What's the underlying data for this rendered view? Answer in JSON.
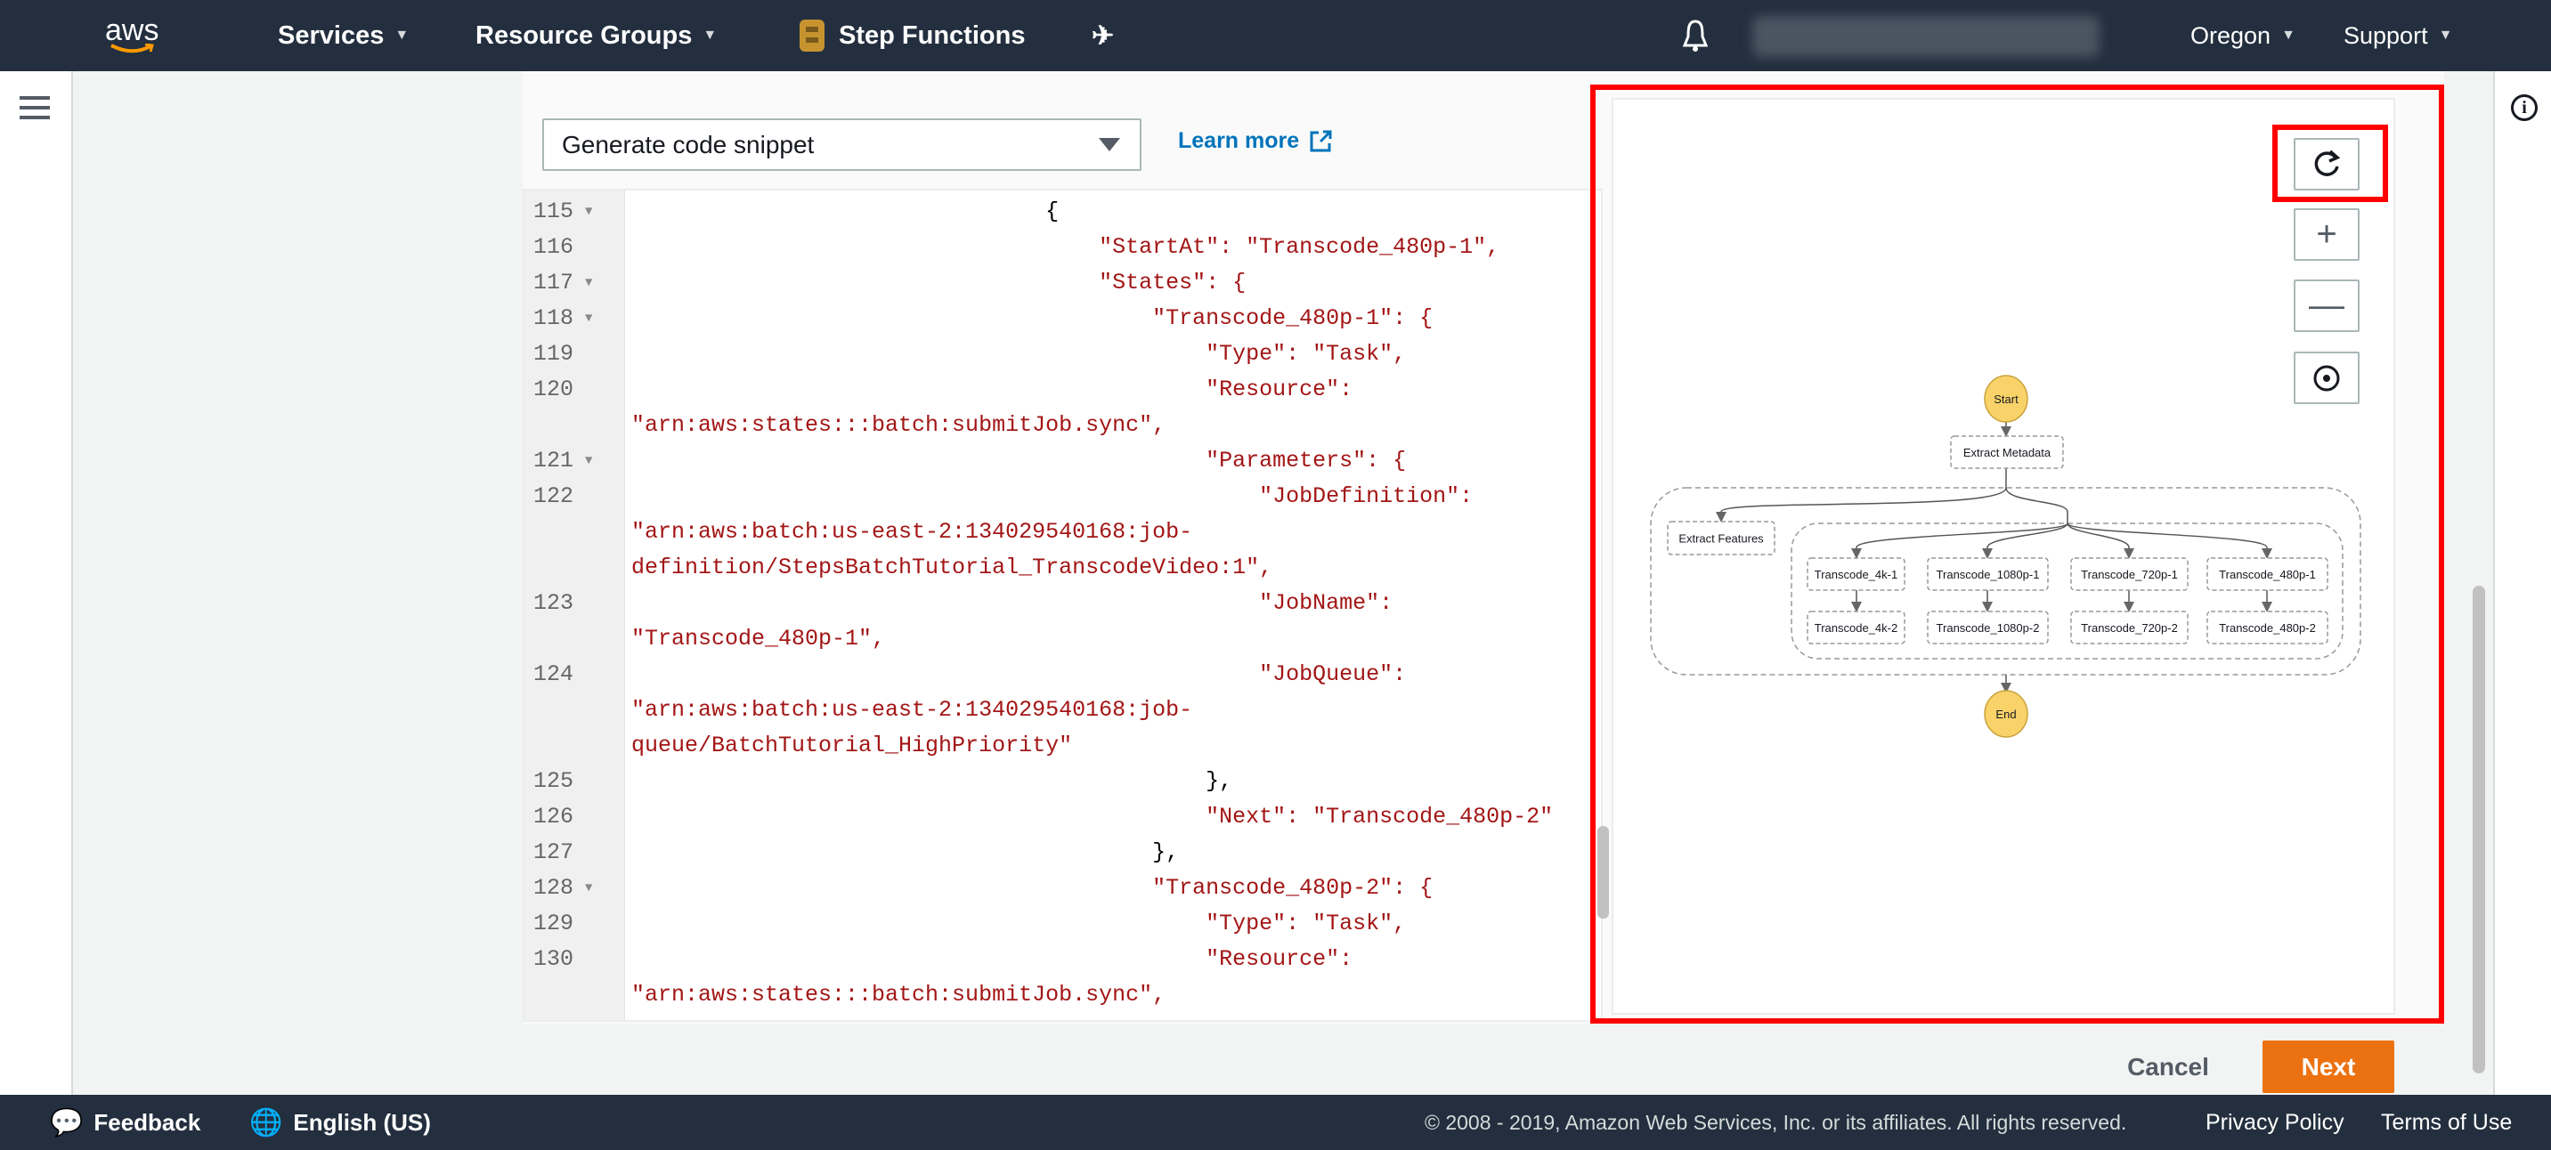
{
  "topnav": {
    "logo": "aws",
    "services": "Services",
    "resource_groups": "Resource Groups",
    "step_functions": "Step Functions",
    "account": "",
    "region": "Oregon",
    "support": "Support",
    "icons": [
      "pin-icon",
      "bell-icon"
    ]
  },
  "toolbar": {
    "snippet_select": "Generate code snippet",
    "learn_more": "Learn more"
  },
  "editor": {
    "rows": [
      {
        "ln": "115",
        "fold": true,
        "text": "                               {"
      },
      {
        "ln": "116",
        "fold": false,
        "text": "                                   \"StartAt\": \"Transcode_480p-1\","
      },
      {
        "ln": "117",
        "fold": true,
        "text": "                                   \"States\": {"
      },
      {
        "ln": "118",
        "fold": true,
        "text": "                                       \"Transcode_480p-1\": {"
      },
      {
        "ln": "119",
        "fold": false,
        "text": "                                           \"Type\": \"Task\","
      },
      {
        "ln": "120",
        "fold": false,
        "text": "                                           \"Resource\":"
      },
      {
        "ln": "",
        "fold": false,
        "text": "\"arn:aws:states:::batch:submitJob.sync\","
      },
      {
        "ln": "121",
        "fold": true,
        "text": "                                           \"Parameters\": {"
      },
      {
        "ln": "122",
        "fold": false,
        "text": "                                               \"JobDefinition\":"
      },
      {
        "ln": "",
        "fold": false,
        "text": "\"arn:aws:batch:us-east-2:134029540168:job-"
      },
      {
        "ln": "",
        "fold": false,
        "text": "definition/StepsBatchTutorial_TranscodeVideo:1\","
      },
      {
        "ln": "123",
        "fold": false,
        "text": "                                               \"JobName\":"
      },
      {
        "ln": "",
        "fold": false,
        "text": "\"Transcode_480p-1\","
      },
      {
        "ln": "124",
        "fold": false,
        "text": "                                               \"JobQueue\":"
      },
      {
        "ln": "",
        "fold": false,
        "text": "\"arn:aws:batch:us-east-2:134029540168:job-"
      },
      {
        "ln": "",
        "fold": false,
        "text": "queue/BatchTutorial_HighPriority\""
      },
      {
        "ln": "125",
        "fold": false,
        "text": "                                           },"
      },
      {
        "ln": "126",
        "fold": false,
        "text": "                                           \"Next\": \"Transcode_480p-2\""
      },
      {
        "ln": "127",
        "fold": false,
        "text": "                                       },"
      },
      {
        "ln": "128",
        "fold": true,
        "text": "                                       \"Transcode_480p-2\": {"
      },
      {
        "ln": "129",
        "fold": false,
        "text": "                                           \"Type\": \"Task\","
      },
      {
        "ln": "130",
        "fold": false,
        "text": "                                           \"Resource\":"
      },
      {
        "ln": "",
        "fold": false,
        "text": "\"arn:aws:states:::batch:submitJob.sync\","
      }
    ]
  },
  "graph": {
    "controls": [
      "refresh-icon",
      "zoom-in-icon",
      "zoom-out-icon",
      "center-icon"
    ],
    "nodes": {
      "start": "Start",
      "extract_metadata": "Extract Metadata",
      "extract_features": "Extract Features",
      "t4k1": "Transcode_4k-1",
      "t1080p1": "Transcode_1080p-1",
      "t720p1": "Transcode_720p-1",
      "t480p1": "Transcode_480p-1",
      "t4k2": "Transcode_4k-2",
      "t1080p2": "Transcode_1080p-2",
      "t720p2": "Transcode_720p-2",
      "t480p2": "Transcode_480p-2",
      "end": "End"
    },
    "colors": {
      "terminal": "#f9d36a",
      "highlight": "#ff0000"
    }
  },
  "actions": {
    "cancel": "Cancel",
    "next": "Next"
  },
  "footer": {
    "feedback": "Feedback",
    "language": "English (US)",
    "copyright": "© 2008 - 2019, Amazon Web Services, Inc. or its affiliates. All rights reserved.",
    "privacy": "Privacy Policy",
    "terms": "Terms of Use"
  }
}
